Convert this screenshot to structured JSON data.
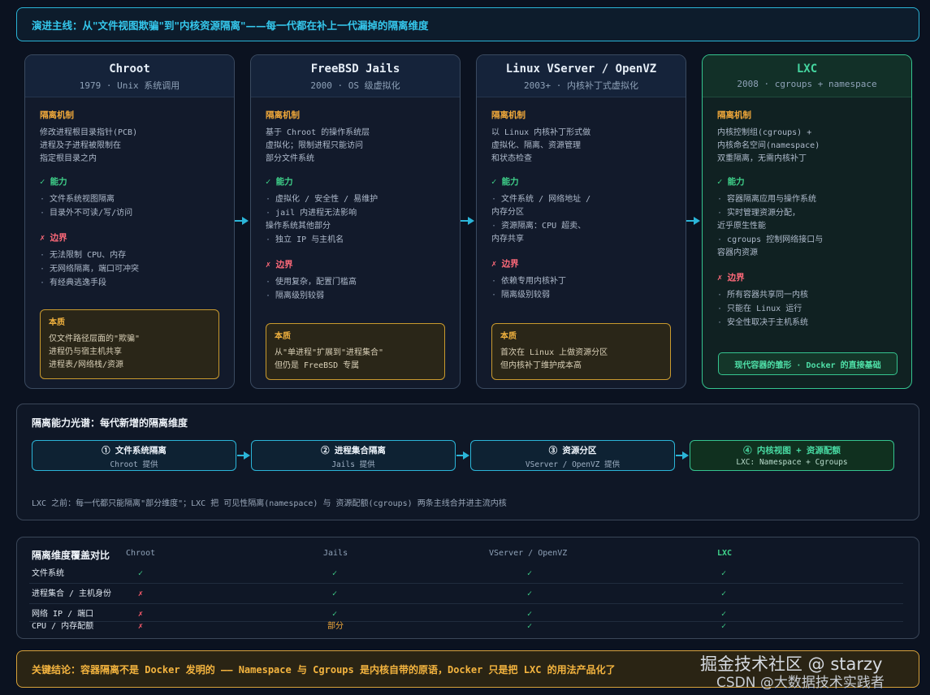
{
  "banner": "演进主线：从\"文件视图欺骗\"到\"内核资源隔离\"——每一代都在补上一代漏掉的隔离维度",
  "labels": {
    "mechanism": "隔离机制",
    "ability": "✓ 能力",
    "limit": "✗ 边界",
    "essence": "本质"
  },
  "eras": [
    {
      "title": "Chroot",
      "subtitle": "1979 · Unix 系统调用",
      "mechanism": "修改进程根目录指针(PCB)\n进程及子进程被限制在\n指定根目录之内",
      "abilities": [
        "文件系统视图隔离",
        "目录外不可读/写/访问"
      ],
      "limits": [
        "无法限制 CPU、内存",
        "无网络隔离，端口可冲突",
        "有经典逃逸手段"
      ],
      "essence": "仅文件路径层面的\"欺骗\"\n进程仍与宿主机共享\n进程表/网络栈/资源"
    },
    {
      "title": "FreeBSD Jails",
      "subtitle": "2000 · OS 级虚拟化",
      "mechanism": "基于 Chroot 的操作系统层\n虚拟化；限制进程只能访问\n部分文件系统",
      "abilities": [
        "虚拟化 / 安全性 / 易维护",
        "jail 内进程无法影响\n操作系统其他部分",
        "独立 IP 与主机名"
      ],
      "limits": [
        "使用复杂，配置门槛高",
        "隔离级别较弱"
      ],
      "essence": "从\"单进程\"扩展到\"进程集合\"\n但仍是 FreeBSD 专属"
    },
    {
      "title": "Linux VServer / OpenVZ",
      "subtitle": "2003+ · 内核补丁式虚拟化",
      "mechanism": "以 Linux 内核补丁形式做\n虚拟化、隔离、资源管理\n和状态检查",
      "abilities": [
        "文件系统 / 网络地址 /\n内存分区",
        "资源隔离：CPU 超卖、\n内存共享"
      ],
      "limits": [
        "依赖专用内核补丁",
        "隔离级别较弱"
      ],
      "essence": "首次在 Linux 上做资源分区\n但内核补丁维护成本高"
    },
    {
      "title": "LXC",
      "subtitle": "2008 · cgroups + namespace",
      "mechanism": "内核控制组(cgroups) +\n内核命名空间(namespace)\n双重隔离，无需内核补丁",
      "abilities": [
        "容器隔离应用与操作系统",
        "实时管理资源分配，\n近乎原生性能",
        "cgroups 控制网络接口与\n容器内资源"
      ],
      "limits": [
        "所有容器共享同一内核",
        "只能在 Linux 运行",
        "安全性取决于主机系统"
      ],
      "footer": "现代容器的雏形 · Docker 的直接基础"
    }
  ],
  "spectrum": {
    "title": "隔离能力光谱：每代新增的隔离维度",
    "steps": [
      {
        "title": "① 文件系统隔离",
        "sub": "Chroot 提供"
      },
      {
        "title": "② 进程集合隔离",
        "sub": "Jails 提供"
      },
      {
        "title": "③ 资源分区",
        "sub": "VServer / OpenVZ 提供"
      },
      {
        "title": "④ 内核视图 + 资源配额",
        "sub": "LXC: Namespace + Cgroups"
      }
    ],
    "note": "LXC 之前：每一代都只能隔离\"部分维度\"；LXC 把 可见性隔离(namespace) 与 资源配额(cgroups) 两条主线合并进主流内核"
  },
  "coverage": {
    "title": "隔离维度覆盖对比",
    "columns": [
      "Chroot",
      "Jails",
      "VServer / OpenVZ",
      "LXC"
    ],
    "rows": [
      {
        "label": "文件系统",
        "cells": [
          "✓",
          "✓",
          "✓",
          "✓"
        ]
      },
      {
        "label": "进程集合 / 主机身份",
        "cells": [
          "✗",
          "✓",
          "✓",
          "✓"
        ]
      },
      {
        "label": "网络 IP / 端口",
        "cells": [
          "✗",
          "✓",
          "✓",
          "✓"
        ]
      },
      {
        "label": "CPU / 内存配额",
        "cells": [
          "✗",
          "部分",
          "✓",
          "✓"
        ]
      }
    ]
  },
  "conclusion": "关键结论：容器隔离不是 Docker 发明的 —— Namespace 与 Cgroups 是内核自带的原语，Docker 只是把 LXC 的用法产品化了",
  "watermark": {
    "line1": "掘金技术社区 @ starzy",
    "line2": "CSDN @大数据技术实践者"
  },
  "colors": {
    "accent_cyan": "#2ab3d6",
    "accent_green": "#35c48f",
    "accent_amber": "#d8a23a",
    "ok": "#3fd18a",
    "no": "#ff5c6c"
  }
}
